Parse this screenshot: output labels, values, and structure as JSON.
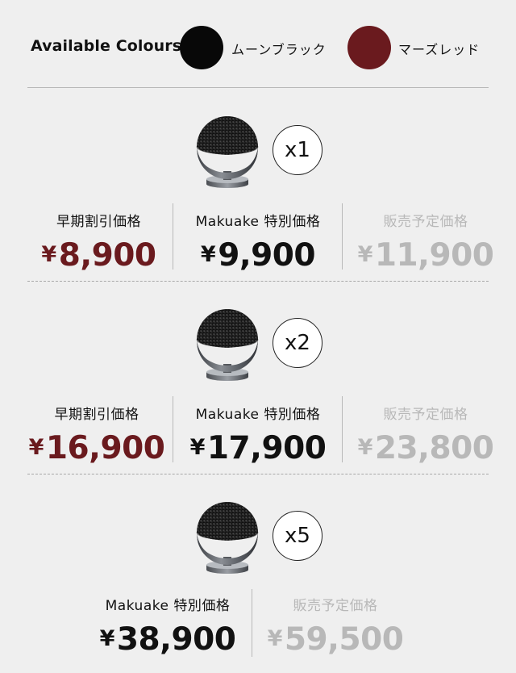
{
  "colours": {
    "label": "Available Colours",
    "options": [
      {
        "name": "ムーンブラック",
        "color": "#080808"
      },
      {
        "name": "マーズレッド",
        "color": "#6a1a1e"
      }
    ]
  },
  "tiers": [
    {
      "quantity": "x1",
      "prices": [
        {
          "label": "早期割引価格",
          "currency": "¥",
          "amount": "8,900"
        },
        {
          "label": "Makuake 特別価格",
          "currency": "¥",
          "amount": "9,900"
        },
        {
          "label": "販売予定価格",
          "currency": "¥",
          "amount": "11,900"
        }
      ]
    },
    {
      "quantity": "x2",
      "prices": [
        {
          "label": "早期割引価格",
          "currency": "¥",
          "amount": "16,900"
        },
        {
          "label": "Makuake 特別価格",
          "currency": "¥",
          "amount": "17,900"
        },
        {
          "label": "販売予定価格",
          "currency": "¥",
          "amount": "23,800"
        }
      ]
    },
    {
      "quantity": "x5",
      "prices": [
        {
          "label": "Makuake 特別価格",
          "currency": "¥",
          "amount": "38,900"
        },
        {
          "label": "販売予定価格",
          "currency": "¥",
          "amount": "59,500"
        }
      ]
    }
  ],
  "theme": {
    "accent": "#6a1a1e",
    "muted": "#b8b8b8",
    "background": "#efefef"
  }
}
